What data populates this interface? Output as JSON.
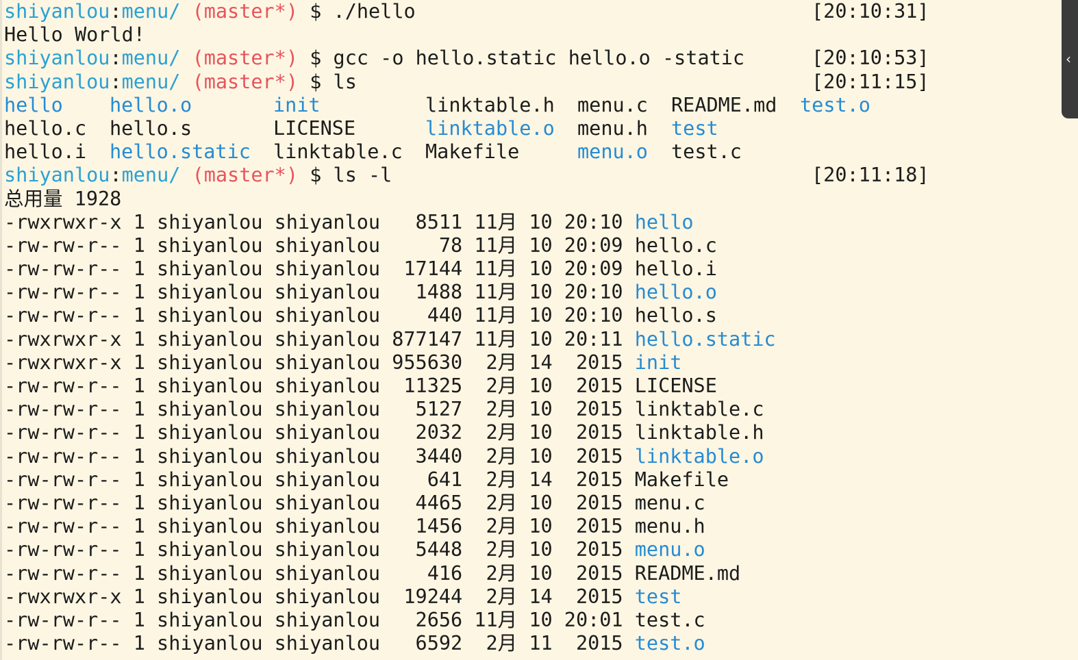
{
  "prompts": [
    {
      "user": "shiyanlou",
      "sep": ":",
      "dir": "menu/",
      "branch": "(master*)",
      "dollar": "$",
      "cmd": "./hello",
      "time": "[20:10:31]"
    },
    {
      "user": "shiyanlou",
      "sep": ":",
      "dir": "menu/",
      "branch": "(master*)",
      "dollar": "$",
      "cmd": "gcc -o hello.static hello.o -static",
      "time": "[20:10:53]"
    },
    {
      "user": "shiyanlou",
      "sep": ":",
      "dir": "menu/",
      "branch": "(master*)",
      "dollar": "$",
      "cmd": "ls",
      "time": "[20:11:15]"
    },
    {
      "user": "shiyanlou",
      "sep": ":",
      "dir": "menu/",
      "branch": "(master*)",
      "dollar": "$",
      "cmd": "ls -l",
      "time": "[20:11:18]"
    }
  ],
  "hello_output": "Hello World!",
  "ls_grid": [
    [
      {
        "t": "hello",
        "c": "blue"
      },
      {
        "t": "hello.o",
        "c": "blue"
      },
      {
        "t": "init",
        "c": "blue"
      },
      {
        "t": "linktable.h",
        "c": ""
      },
      {
        "t": "menu.c",
        "c": ""
      },
      {
        "t": "README.md",
        "c": ""
      },
      {
        "t": "test.o",
        "c": "blue"
      }
    ],
    [
      {
        "t": "hello.c",
        "c": ""
      },
      {
        "t": "hello.s",
        "c": ""
      },
      {
        "t": "LICENSE",
        "c": ""
      },
      {
        "t": "linktable.o",
        "c": "blue"
      },
      {
        "t": "menu.h",
        "c": ""
      },
      {
        "t": "test",
        "c": "blue"
      }
    ],
    [
      {
        "t": "hello.i",
        "c": ""
      },
      {
        "t": "hello.static",
        "c": "blue"
      },
      {
        "t": "linktable.c",
        "c": ""
      },
      {
        "t": "Makefile",
        "c": ""
      },
      {
        "t": "menu.o",
        "c": "blue"
      },
      {
        "t": "test.c",
        "c": ""
      }
    ]
  ],
  "total_label": "总用量 1928",
  "ls_long": [
    {
      "prefix": "-rwxrwxr-x 1 shiyanlou shiyanlou   8511 11月 10 20:10 ",
      "name": "hello",
      "c": "blue"
    },
    {
      "prefix": "-rw-rw-r-- 1 shiyanlou shiyanlou     78 11月 10 20:09 ",
      "name": "hello.c",
      "c": ""
    },
    {
      "prefix": "-rw-rw-r-- 1 shiyanlou shiyanlou  17144 11月 10 20:09 ",
      "name": "hello.i",
      "c": ""
    },
    {
      "prefix": "-rw-rw-r-- 1 shiyanlou shiyanlou   1488 11月 10 20:10 ",
      "name": "hello.o",
      "c": "blue"
    },
    {
      "prefix": "-rw-rw-r-- 1 shiyanlou shiyanlou    440 11月 10 20:10 ",
      "name": "hello.s",
      "c": ""
    },
    {
      "prefix": "-rwxrwxr-x 1 shiyanlou shiyanlou 877147 11月 10 20:11 ",
      "name": "hello.static",
      "c": "blue"
    },
    {
      "prefix": "-rwxrwxr-x 1 shiyanlou shiyanlou 955630  2月 14  2015 ",
      "name": "init",
      "c": "blue"
    },
    {
      "prefix": "-rw-rw-r-- 1 shiyanlou shiyanlou  11325  2月 10  2015 ",
      "name": "LICENSE",
      "c": ""
    },
    {
      "prefix": "-rw-rw-r-- 1 shiyanlou shiyanlou   5127  2月 10  2015 ",
      "name": "linktable.c",
      "c": ""
    },
    {
      "prefix": "-rw-rw-r-- 1 shiyanlou shiyanlou   2032  2月 10  2015 ",
      "name": "linktable.h",
      "c": ""
    },
    {
      "prefix": "-rw-rw-r-- 1 shiyanlou shiyanlou   3440  2月 10  2015 ",
      "name": "linktable.o",
      "c": "blue"
    },
    {
      "prefix": "-rw-rw-r-- 1 shiyanlou shiyanlou    641  2月 14  2015 ",
      "name": "Makefile",
      "c": ""
    },
    {
      "prefix": "-rw-rw-r-- 1 shiyanlou shiyanlou   4465  2月 10  2015 ",
      "name": "menu.c",
      "c": ""
    },
    {
      "prefix": "-rw-rw-r-- 1 shiyanlou shiyanlou   1456  2月 10  2015 ",
      "name": "menu.h",
      "c": ""
    },
    {
      "prefix": "-rw-rw-r-- 1 shiyanlou shiyanlou   5448  2月 10  2015 ",
      "name": "menu.o",
      "c": "blue"
    },
    {
      "prefix": "-rw-rw-r-- 1 shiyanlou shiyanlou    416  2月 10  2015 ",
      "name": "README.md",
      "c": ""
    },
    {
      "prefix": "-rwxrwxr-x 1 shiyanlou shiyanlou  19244  2月 14  2015 ",
      "name": "test",
      "c": "blue"
    },
    {
      "prefix": "-rw-rw-r-- 1 shiyanlou shiyanlou   2656 11月 10 20:01 ",
      "name": "test.c",
      "c": ""
    },
    {
      "prefix": "-rw-rw-r-- 1 shiyanlou shiyanlou   6592  2月 11  2015 ",
      "name": "test.o",
      "c": "blue"
    }
  ],
  "scrollbar": {
    "icon": "chevron-left-icon",
    "glyph": "‹"
  },
  "colors": {
    "background": "#fdf6e3",
    "user": "#2aa1d3",
    "branch": "#e8545c",
    "exec": "#268bd2",
    "text": "#1c1c1c"
  }
}
